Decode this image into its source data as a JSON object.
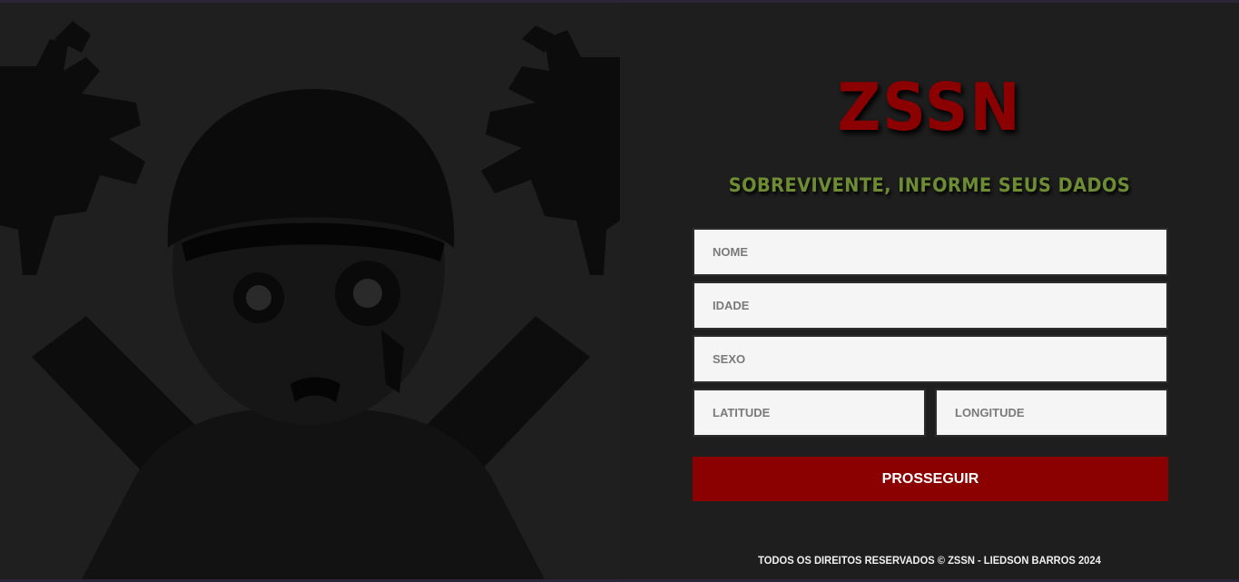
{
  "brand": {
    "logo_text": "ZSSN",
    "logo_color": "#8b0000"
  },
  "form": {
    "heading": "SOBREVIVENTE, INFORME SEUS DADOS",
    "heading_color": "#6e8c34",
    "fields": {
      "nome": {
        "placeholder": "NOME",
        "value": ""
      },
      "idade": {
        "placeholder": "IDADE",
        "value": ""
      },
      "sexo": {
        "placeholder": "SEXO",
        "value": ""
      },
      "latitude": {
        "placeholder": "LATITUDE",
        "value": ""
      },
      "longitude": {
        "placeholder": "LONGITUDE",
        "value": ""
      }
    },
    "submit_label": "PROSSEGUIR",
    "submit_color": "#8b0000"
  },
  "illustration": {
    "icon": "zombie-survivor-illustration"
  },
  "footer": {
    "text": "TODOS OS DIREITOS RESERVADOS © ZSSN - LIEDSON BARROS 2024"
  }
}
